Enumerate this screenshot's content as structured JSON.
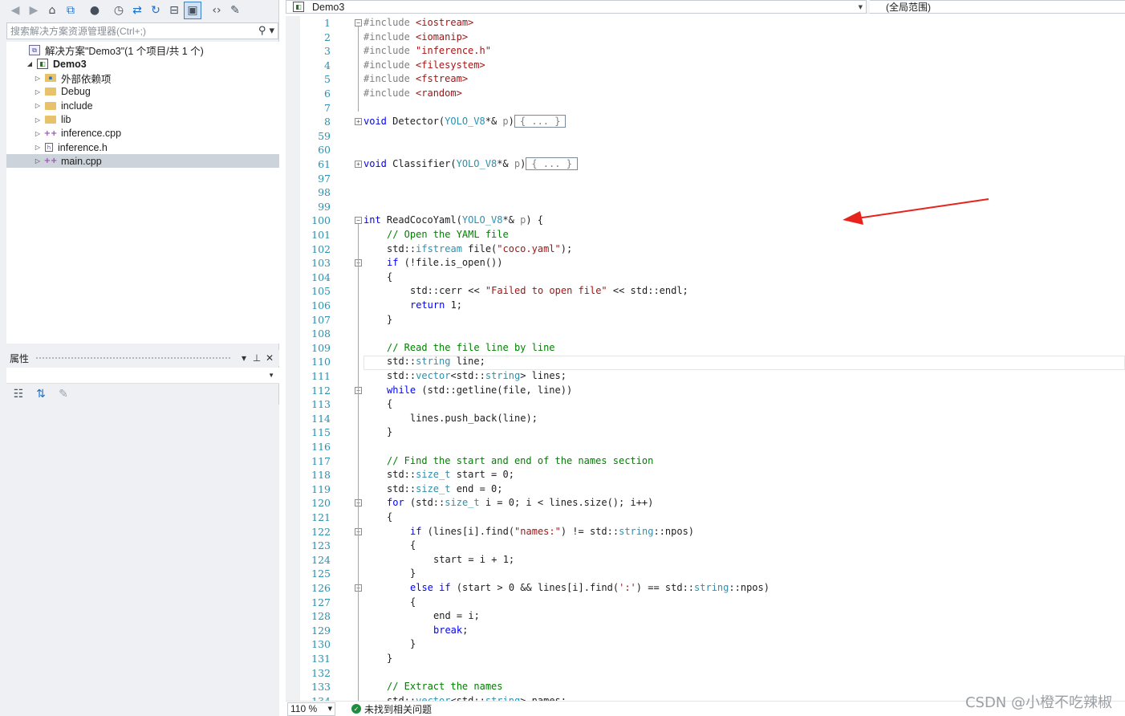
{
  "solution_explorer": {
    "search_placeholder": "搜索解决方案资源管理器(Ctrl+;)",
    "tree": [
      {
        "label": "解决方案\"Demo3\"(1 个项目/共 1 个)",
        "kind": "solution",
        "arrow": "",
        "indent": 0,
        "bold": false,
        "selected": false
      },
      {
        "label": "Demo3",
        "kind": "project",
        "arrow": "◢",
        "indent": 1,
        "bold": true,
        "selected": false
      },
      {
        "label": "外部依赖项",
        "kind": "deps",
        "arrow": "▷",
        "indent": 2,
        "bold": false,
        "selected": false
      },
      {
        "label": "Debug",
        "kind": "folder",
        "arrow": "▷",
        "indent": 2,
        "bold": false,
        "selected": false
      },
      {
        "label": "include",
        "kind": "folder",
        "arrow": "▷",
        "indent": 2,
        "bold": false,
        "selected": false
      },
      {
        "label": "lib",
        "kind": "folder",
        "arrow": "▷",
        "indent": 2,
        "bold": false,
        "selected": false
      },
      {
        "label": "inference.cpp",
        "kind": "cpp",
        "arrow": "▷",
        "indent": 2,
        "bold": false,
        "selected": false
      },
      {
        "label": "inference.h",
        "kind": "h",
        "arrow": "▷",
        "indent": 2,
        "bold": false,
        "selected": false
      },
      {
        "label": "main.cpp",
        "kind": "cpp",
        "arrow": "▷",
        "indent": 2,
        "bold": false,
        "selected": true
      }
    ]
  },
  "properties": {
    "title": "属性"
  },
  "editor": {
    "file_tab": "Demo3",
    "scope": "(全局范围)",
    "zoom": "110 %",
    "issues": "未找到相关问题",
    "lines": [
      {
        "n": "1",
        "indent": 0,
        "fold": "minus",
        "parts": [
          [
            "p",
            "#include "
          ],
          [
            "s",
            "<iostream>"
          ]
        ]
      },
      {
        "n": "2",
        "indent": 0,
        "parts": [
          [
            "p",
            "#include "
          ],
          [
            "s",
            "<iomanip>"
          ]
        ]
      },
      {
        "n": "3",
        "indent": 0,
        "parts": [
          [
            "p",
            "#include "
          ],
          [
            "s",
            "\"inference.h\""
          ]
        ]
      },
      {
        "n": "4",
        "indent": 0,
        "parts": [
          [
            "p",
            "#include "
          ],
          [
            "s",
            "<filesystem>"
          ]
        ]
      },
      {
        "n": "5",
        "indent": 0,
        "parts": [
          [
            "p",
            "#include "
          ],
          [
            "s",
            "<fstream>"
          ]
        ]
      },
      {
        "n": "6",
        "indent": 0,
        "parts": [
          [
            "p",
            "#include "
          ],
          [
            "s",
            "<random>"
          ]
        ]
      },
      {
        "n": "7",
        "indent": 0,
        "parts": []
      },
      {
        "n": "8",
        "indent": 0,
        "fold": "plus",
        "parts": [
          [
            "k",
            "void"
          ],
          [
            "",
            " Detector("
          ],
          [
            "t",
            "YOLO_V8"
          ],
          [
            "",
            "*& "
          ],
          [
            "p",
            "p"
          ],
          [
            "",
            ")"
          ],
          [
            "box",
            "{ ... }"
          ]
        ]
      },
      {
        "n": "59",
        "indent": 0,
        "parts": []
      },
      {
        "n": "60",
        "indent": 0,
        "parts": []
      },
      {
        "n": "61",
        "indent": 0,
        "fold": "plus",
        "parts": [
          [
            "k",
            "void"
          ],
          [
            "",
            " Classifier("
          ],
          [
            "t",
            "YOLO_V8"
          ],
          [
            "",
            "*& "
          ],
          [
            "p",
            "p"
          ],
          [
            "",
            ")"
          ],
          [
            "box",
            "{ ... }"
          ]
        ]
      },
      {
        "n": "97",
        "indent": 0,
        "parts": []
      },
      {
        "n": "98",
        "indent": 0,
        "parts": []
      },
      {
        "n": "99",
        "indent": 0,
        "parts": []
      },
      {
        "n": "100",
        "indent": 0,
        "fold": "minus",
        "parts": [
          [
            "k",
            "int"
          ],
          [
            "",
            " ReadCocoYaml("
          ],
          [
            "t",
            "YOLO_V8"
          ],
          [
            "",
            "*& "
          ],
          [
            "p",
            "p"
          ],
          [
            "",
            ") {"
          ]
        ]
      },
      {
        "n": "101",
        "indent": 1,
        "parts": [
          [
            "c",
            "// Open the YAML file"
          ]
        ]
      },
      {
        "n": "102",
        "indent": 1,
        "parts": [
          [
            "",
            "std::"
          ],
          [
            "t",
            "ifstream"
          ],
          [
            "",
            " file("
          ],
          [
            "s",
            "\"coco.yaml\""
          ],
          [
            "",
            ");"
          ]
        ]
      },
      {
        "n": "103",
        "indent": 1,
        "fold": "minus",
        "parts": [
          [
            "k",
            "if"
          ],
          [
            "",
            " (!file.is_open())"
          ]
        ]
      },
      {
        "n": "104",
        "indent": 1,
        "parts": [
          [
            "",
            "{"
          ]
        ]
      },
      {
        "n": "105",
        "indent": 2,
        "parts": [
          [
            "",
            "std::cerr << "
          ],
          [
            "s",
            "\"Failed to open file\""
          ],
          [
            "",
            " << std::endl;"
          ]
        ]
      },
      {
        "n": "106",
        "indent": 2,
        "parts": [
          [
            "k",
            "return"
          ],
          [
            "",
            " 1;"
          ]
        ]
      },
      {
        "n": "107",
        "indent": 1,
        "parts": [
          [
            "",
            "}"
          ]
        ]
      },
      {
        "n": "108",
        "indent": 1,
        "parts": []
      },
      {
        "n": "109",
        "indent": 1,
        "parts": [
          [
            "c",
            "// Read the file line by line"
          ]
        ]
      },
      {
        "n": "110",
        "indent": 1,
        "parts": [
          [
            "",
            "std::"
          ],
          [
            "t",
            "string"
          ],
          [
            "",
            " line;"
          ]
        ]
      },
      {
        "n": "111",
        "indent": 1,
        "parts": [
          [
            "",
            "std::"
          ],
          [
            "t",
            "vector"
          ],
          [
            "",
            "<std::"
          ],
          [
            "t",
            "string"
          ],
          [
            "",
            "> lines;"
          ]
        ]
      },
      {
        "n": "112",
        "indent": 1,
        "fold": "minus",
        "parts": [
          [
            "k",
            "while"
          ],
          [
            "",
            " (std::getline(file, line))"
          ]
        ]
      },
      {
        "n": "113",
        "indent": 1,
        "parts": [
          [
            "",
            "{"
          ]
        ]
      },
      {
        "n": "114",
        "indent": 2,
        "parts": [
          [
            "",
            "lines.push_back(line);"
          ]
        ]
      },
      {
        "n": "115",
        "indent": 1,
        "parts": [
          [
            "",
            "}"
          ]
        ]
      },
      {
        "n": "116",
        "indent": 1,
        "parts": []
      },
      {
        "n": "117",
        "indent": 1,
        "parts": [
          [
            "c",
            "// Find the start and end of the names section"
          ]
        ]
      },
      {
        "n": "118",
        "indent": 1,
        "parts": [
          [
            "",
            "std::"
          ],
          [
            "t",
            "size_t"
          ],
          [
            "",
            " start = 0;"
          ]
        ]
      },
      {
        "n": "119",
        "indent": 1,
        "parts": [
          [
            "",
            "std::"
          ],
          [
            "t",
            "size_t"
          ],
          [
            "",
            " end = 0;"
          ]
        ]
      },
      {
        "n": "120",
        "indent": 1,
        "fold": "minus",
        "parts": [
          [
            "k",
            "for"
          ],
          [
            "",
            " (std::"
          ],
          [
            "t",
            "size_t"
          ],
          [
            "",
            " i = 0; i < lines.size(); i++)"
          ]
        ]
      },
      {
        "n": "121",
        "indent": 1,
        "parts": [
          [
            "",
            "{"
          ]
        ]
      },
      {
        "n": "122",
        "indent": 2,
        "fold": "minus",
        "parts": [
          [
            "k",
            "if"
          ],
          [
            "",
            " (lines[i].find("
          ],
          [
            "s",
            "\"names:\""
          ],
          [
            "",
            ") != std::"
          ],
          [
            "t",
            "string"
          ],
          [
            "",
            "::npos)"
          ]
        ]
      },
      {
        "n": "123",
        "indent": 2,
        "parts": [
          [
            "",
            "{"
          ]
        ]
      },
      {
        "n": "124",
        "indent": 3,
        "parts": [
          [
            "",
            "start = i + 1;"
          ]
        ]
      },
      {
        "n": "125",
        "indent": 2,
        "parts": [
          [
            "",
            "}"
          ]
        ]
      },
      {
        "n": "126",
        "indent": 2,
        "fold": "minus",
        "parts": [
          [
            "k",
            "else if"
          ],
          [
            "",
            " (start > 0 && lines[i].find("
          ],
          [
            "s",
            "':'"
          ],
          [
            "",
            ") == std::"
          ],
          [
            "t",
            "string"
          ],
          [
            "",
            "::npos)"
          ]
        ]
      },
      {
        "n": "127",
        "indent": 2,
        "parts": [
          [
            "",
            "{"
          ]
        ]
      },
      {
        "n": "128",
        "indent": 3,
        "parts": [
          [
            "",
            "end = i;"
          ]
        ]
      },
      {
        "n": "129",
        "indent": 3,
        "parts": [
          [
            "k",
            "break"
          ],
          [
            "",
            ";"
          ]
        ]
      },
      {
        "n": "130",
        "indent": 2,
        "parts": [
          [
            "",
            "}"
          ]
        ]
      },
      {
        "n": "131",
        "indent": 1,
        "parts": [
          [
            "",
            "}"
          ]
        ]
      },
      {
        "n": "132",
        "indent": 1,
        "parts": []
      },
      {
        "n": "133",
        "indent": 1,
        "parts": [
          [
            "c",
            "// Extract the names"
          ]
        ]
      },
      {
        "n": "134",
        "indent": 1,
        "parts": [
          [
            "",
            "std::"
          ],
          [
            "t",
            "vector"
          ],
          [
            "",
            "<std::"
          ],
          [
            "t",
            "string"
          ],
          [
            "",
            "> names;"
          ]
        ]
      }
    ]
  },
  "watermark": "CSDN @小橙不吃辣椒"
}
